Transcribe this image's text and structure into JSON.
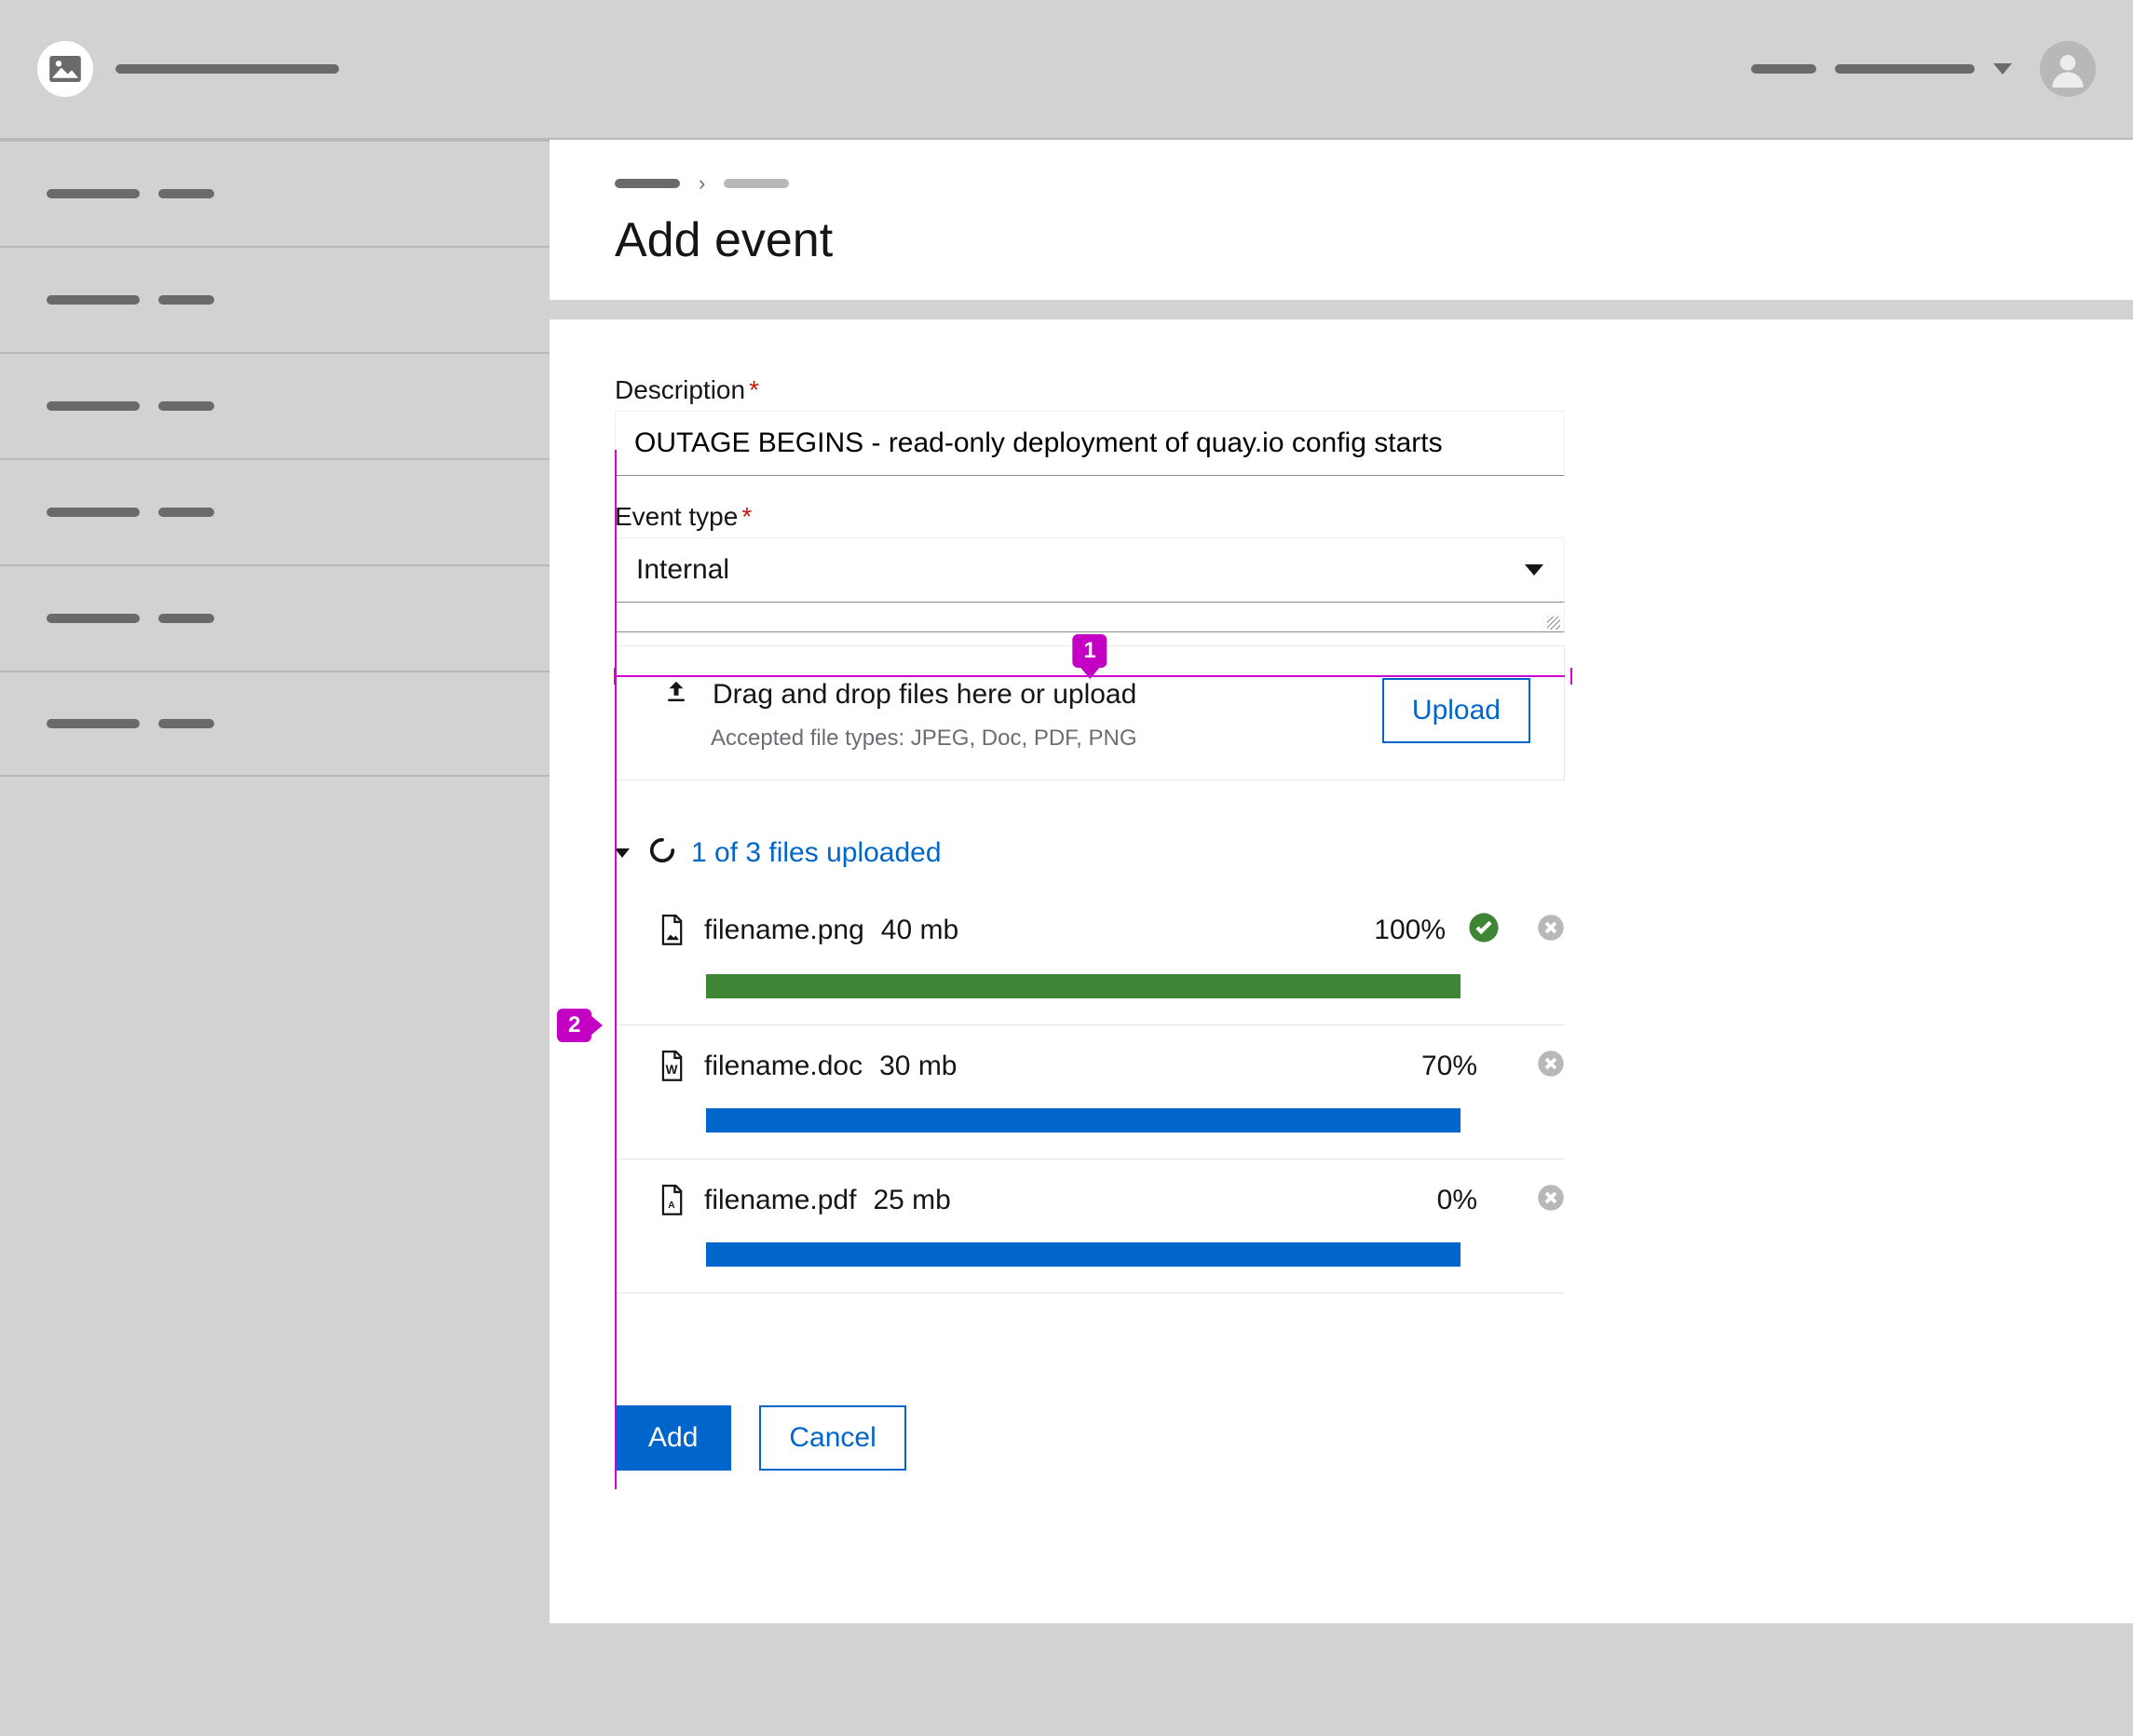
{
  "page": {
    "title": "Add event"
  },
  "form": {
    "description": {
      "label": "Description",
      "value": "OUTAGE BEGINS - read-only deployment of quay.io config starts"
    },
    "event_type": {
      "label": "Event type",
      "value": "Internal"
    }
  },
  "dropzone": {
    "text": "Drag and drop files here or upload",
    "subtext": "Accepted file types: JPEG, Doc, PDF, PNG",
    "upload_btn": "Upload"
  },
  "upload_status": "1 of 3 files uploaded",
  "files": [
    {
      "name": "filename.png",
      "size": "40 mb",
      "pct": "100%",
      "icon": "image",
      "complete": true
    },
    {
      "name": "filename.doc",
      "size": "30 mb",
      "pct": "70%",
      "icon": "word",
      "complete": false
    },
    {
      "name": "filename.pdf",
      "size": "25 mb",
      "pct": "0%",
      "icon": "pdf",
      "complete": false
    }
  ],
  "buttons": {
    "add": "Add",
    "cancel": "Cancel"
  },
  "annotations": {
    "one": "1",
    "two": "2"
  }
}
